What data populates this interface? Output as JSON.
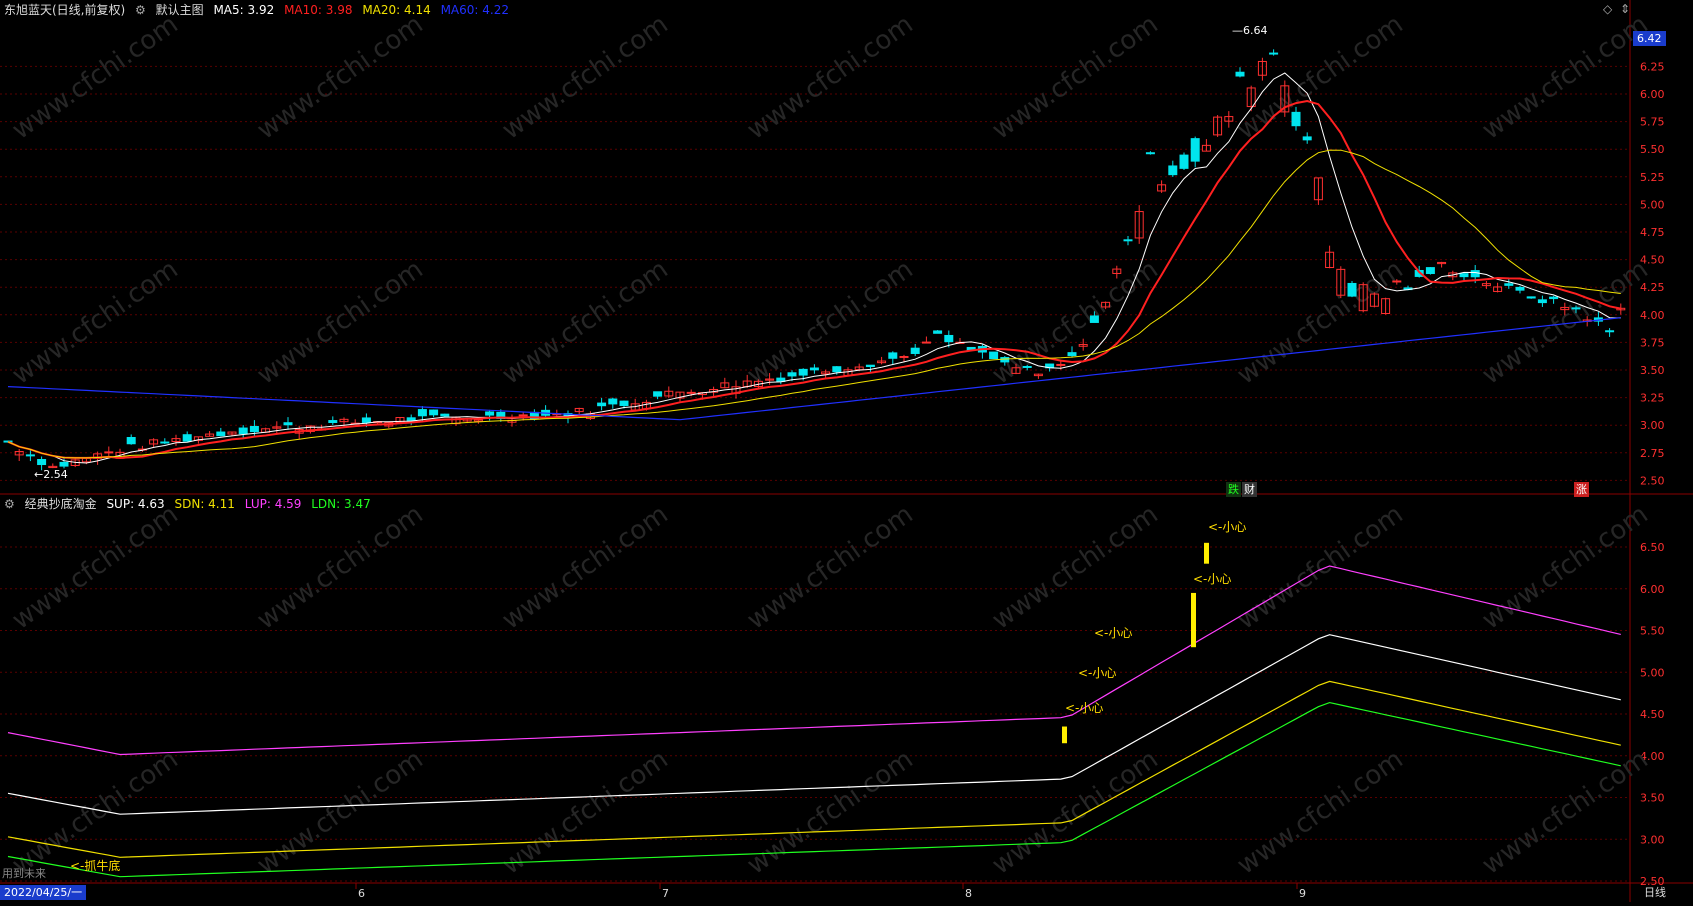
{
  "header": {
    "stock": "东旭蓝天(日线,前复权)",
    "main_chart_label": "默认主图",
    "ma": [
      {
        "label": "MA5: 3.92",
        "color": "#ffffff"
      },
      {
        "label": "MA10: 3.98",
        "color": "#ff2020"
      },
      {
        "label": "MA20: 4.14",
        "color": "#f0e000"
      },
      {
        "label": "MA60: 4.22",
        "color": "#2030ff"
      }
    ]
  },
  "indicator_header": {
    "name": "经典抄底淘金",
    "items": [
      {
        "label": "SUP: 4.63",
        "color": "#ffffff"
      },
      {
        "label": "SDN: 4.11",
        "color": "#f0e000"
      },
      {
        "label": "LUP: 4.59",
        "color": "#ff40ff"
      },
      {
        "label": "LDN: 3.47",
        "color": "#20ff20"
      }
    ]
  },
  "price_axis": {
    "current": "6.42",
    "ticks": [
      "6.25",
      "6.00",
      "5.75",
      "5.50",
      "5.25",
      "5.00",
      "4.75",
      "4.50",
      "4.25",
      "4.00",
      "3.75",
      "3.50",
      "3.25",
      "3.00",
      "2.75",
      "2.50"
    ]
  },
  "indicator_axis": {
    "ticks": [
      "6.50",
      "6.00",
      "5.50",
      "5.00",
      "4.50",
      "4.00",
      "3.50",
      "3.00",
      "2.50"
    ]
  },
  "time_axis": {
    "start": "2022/04/25/一",
    "months": [
      "6",
      "7",
      "8",
      "9"
    ],
    "period": "日线"
  },
  "annotations": {
    "high": "6.64",
    "low": "2.54",
    "drop": "跌",
    "finance": "财",
    "rise": "涨",
    "caution": "<-小心",
    "bottom": "<-抓牛底",
    "future": "用到未来"
  },
  "watermark": "www.cfchi.com",
  "colors": {
    "up": "#ff3030",
    "down": "#00e5ee",
    "grid": "#5a0000"
  }
}
